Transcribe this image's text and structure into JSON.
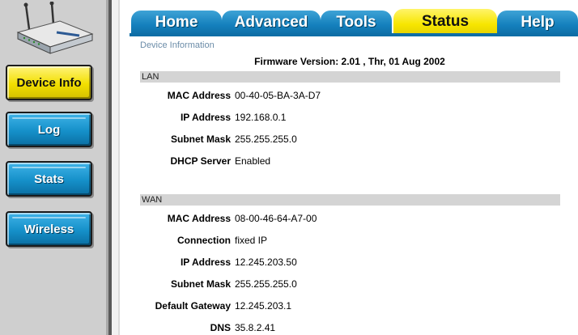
{
  "tabs": [
    {
      "label": "Home",
      "active": false
    },
    {
      "label": "Advanced",
      "active": false
    },
    {
      "label": "Tools",
      "active": false
    },
    {
      "label": "Status",
      "active": true
    },
    {
      "label": "Help",
      "active": false
    }
  ],
  "sidebar": {
    "buttons": [
      {
        "label": "Device Info",
        "active": true
      },
      {
        "label": "Log",
        "active": false
      },
      {
        "label": "Stats",
        "active": false
      },
      {
        "label": "Wireless",
        "active": false
      }
    ]
  },
  "section_title": "Device Information",
  "firmware": "Firmware Version: 2.01 , Thr, 01 Aug 2002",
  "lan": {
    "title": "LAN",
    "rows": [
      {
        "label": "MAC Address",
        "value": "00-40-05-BA-3A-D7"
      },
      {
        "label": "IP Address",
        "value": "192.168.0.1"
      },
      {
        "label": "Subnet Mask",
        "value": "255.255.255.0"
      },
      {
        "label": "DHCP Server",
        "value": "Enabled"
      }
    ]
  },
  "wan": {
    "title": "WAN",
    "rows": [
      {
        "label": "MAC Address",
        "value": "08-00-46-64-A7-00"
      },
      {
        "label": "Connection",
        "value": "fixed IP"
      },
      {
        "label": "IP Address",
        "value": "12.245.203.50"
      },
      {
        "label": "Subnet Mask",
        "value": "255.255.255.0"
      },
      {
        "label": "Default Gateway",
        "value": "12.245.203.1"
      },
      {
        "label": "DNS",
        "value": "35.8.2.41"
      }
    ]
  },
  "colors": {
    "tab_blue": "#1480bd",
    "tab_active_yellow": "#f7e600",
    "sidebar_gray": "#cfcfcf",
    "section_title": "#6b8ca8"
  },
  "icons": {
    "logo": "router-icon"
  }
}
